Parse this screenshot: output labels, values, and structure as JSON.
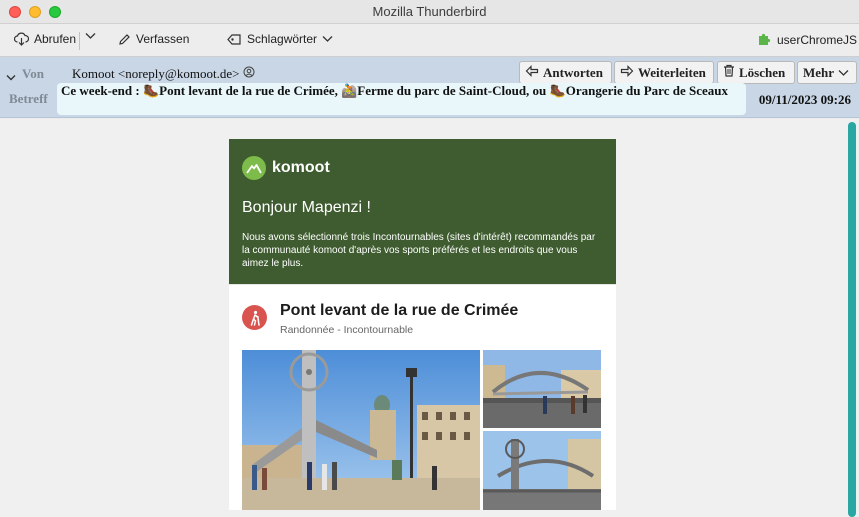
{
  "window": {
    "title": "Mozilla Thunderbird"
  },
  "toolbar": {
    "get_messages": "Abrufen",
    "write": "Verfassen",
    "tags": "Schlagwörter",
    "addon": "userChromeJS"
  },
  "header": {
    "from_label": "Von",
    "from_value": "Komoot <noreply@komoot.de>",
    "subject_label": "Betreff",
    "subject_value": "Ce week-end : 🥾Pont levant de la rue de Crimée, 🚵Ferme du parc de Saint-Cloud, ou 🥾Orangerie du Parc de Sceaux",
    "date": "09/11/2023 09:26",
    "buttons": {
      "reply": "Antworten",
      "forward": "Weiterleiten",
      "delete": "Löschen",
      "more": "Mehr"
    }
  },
  "email": {
    "brand": "komoot",
    "greeting": "Bonjour Mapenzi !",
    "intro": "Nous avons sélectionné trois Incontournables (sites d'intérêt) recommandés par la communauté komoot d'après vos sports préférés et les endroits que vous aimez le plus.",
    "card": {
      "title": "Pont levant de la rue de Crimée",
      "subtitle": "Randonnée - Incontournable"
    }
  }
}
